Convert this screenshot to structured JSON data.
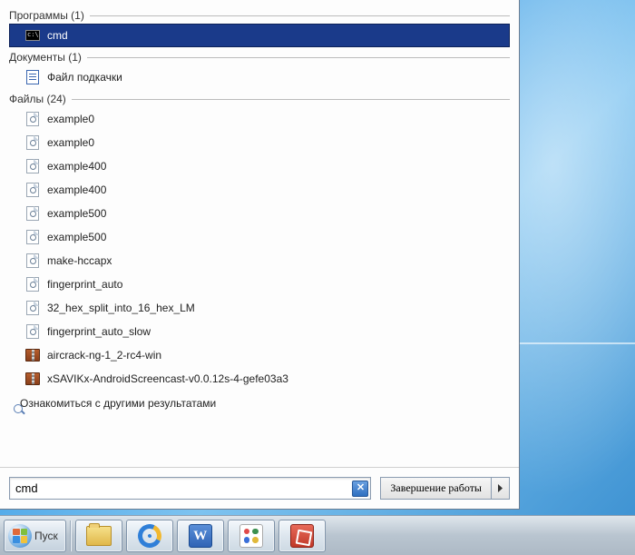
{
  "sections": {
    "programs": {
      "label": "Программы (1)"
    },
    "documents": {
      "label": "Документы (1)"
    },
    "files": {
      "label": "Файлы (24)"
    }
  },
  "programs_items": [
    {
      "name": "cmd",
      "icon": "cmd",
      "selected": true
    }
  ],
  "documents_items": [
    {
      "name": "Файл подкачки",
      "icon": "doc"
    }
  ],
  "files_items": [
    {
      "name": "example0",
      "icon": "file"
    },
    {
      "name": "example0",
      "icon": "file"
    },
    {
      "name": "example400",
      "icon": "file"
    },
    {
      "name": "example400",
      "icon": "file"
    },
    {
      "name": "example500",
      "icon": "file"
    },
    {
      "name": "example500",
      "icon": "file"
    },
    {
      "name": "make-hccapx",
      "icon": "file"
    },
    {
      "name": "fingerprint_auto",
      "icon": "file"
    },
    {
      "name": "32_hex_split_into_16_hex_LM",
      "icon": "file"
    },
    {
      "name": "fingerprint_auto_slow",
      "icon": "file"
    },
    {
      "name": "aircrack-ng-1_2-rc4-win",
      "icon": "archive"
    },
    {
      "name": "xSAVIKx-AndroidScreencast-v0.0.12s-4-gefe03a3",
      "icon": "archive"
    }
  ],
  "more_results_label": "Ознакомиться с другими результатами",
  "search_value": "cmd",
  "shutdown_label": "Завершение работы",
  "start_label": "Пуск"
}
